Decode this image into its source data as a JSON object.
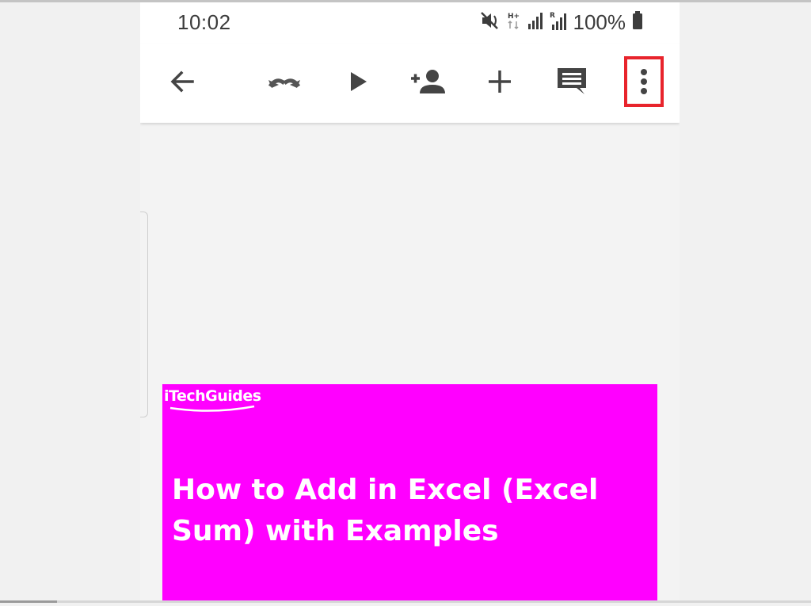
{
  "status_bar": {
    "time": "10:02",
    "battery_percent": "100%",
    "icons": [
      "mute-icon",
      "network-hplus-icon",
      "signal-icon",
      "roaming-signal-icon",
      "battery-icon"
    ]
  },
  "toolbar": {
    "icons": [
      "back-arrow-icon",
      "undo-redo-icon",
      "play-icon",
      "add-person-icon",
      "plus-icon",
      "comment-icon",
      "more-vert-icon"
    ],
    "highlight_color": "#e8242c"
  },
  "slide": {
    "brand": "iTechGuides",
    "title_line1": "How to Add in Excel (Excel",
    "title_line2": "Sum) with Examples",
    "background_color": "#ff00ff"
  }
}
